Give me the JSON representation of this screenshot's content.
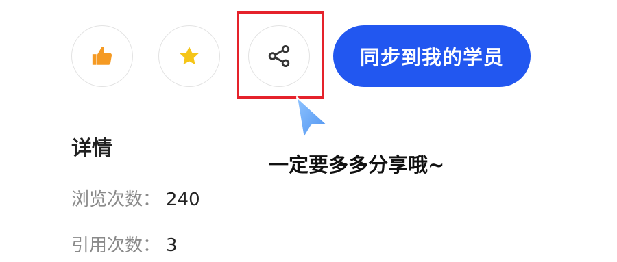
{
  "actions": {
    "like_icon": "thumbs-up-icon",
    "favorite_icon": "star-icon",
    "share_icon": "share-icon",
    "sync_label": "同步到我的学员"
  },
  "annotation": {
    "tip": "一定要多多分享哦~",
    "highlight_color": "#e5222b"
  },
  "details": {
    "title": "详情",
    "views_label": "浏览次数：",
    "views_value": "240",
    "citations_label": "引用次数：",
    "citations_value": "3"
  },
  "colors": {
    "accent": "#2257f0",
    "like": "#f59a23",
    "star": "#f5c518"
  }
}
